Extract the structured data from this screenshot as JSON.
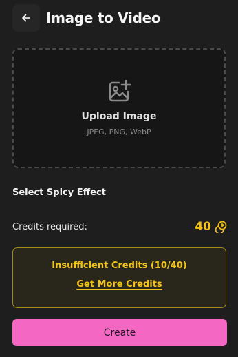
{
  "header": {
    "back_icon": "arrow-left-icon",
    "title": "Image to Video"
  },
  "upload": {
    "icon": "image-add-icon",
    "title": "Upload Image",
    "formats": "JPEG, PNG, WebP"
  },
  "effect_section": {
    "label": "Select Spicy Effect"
  },
  "credits": {
    "label": "Credits required:",
    "value": "40",
    "icon": "coin-icon",
    "accent_color": "#f5c016"
  },
  "warning": {
    "message": "Insufficient Credits (10/40)",
    "link_label": "Get More Credits",
    "border_color": "#a88916",
    "text_color": "#f2c31b"
  },
  "actions": {
    "create_label": "Create",
    "create_color": "#f468c4"
  }
}
